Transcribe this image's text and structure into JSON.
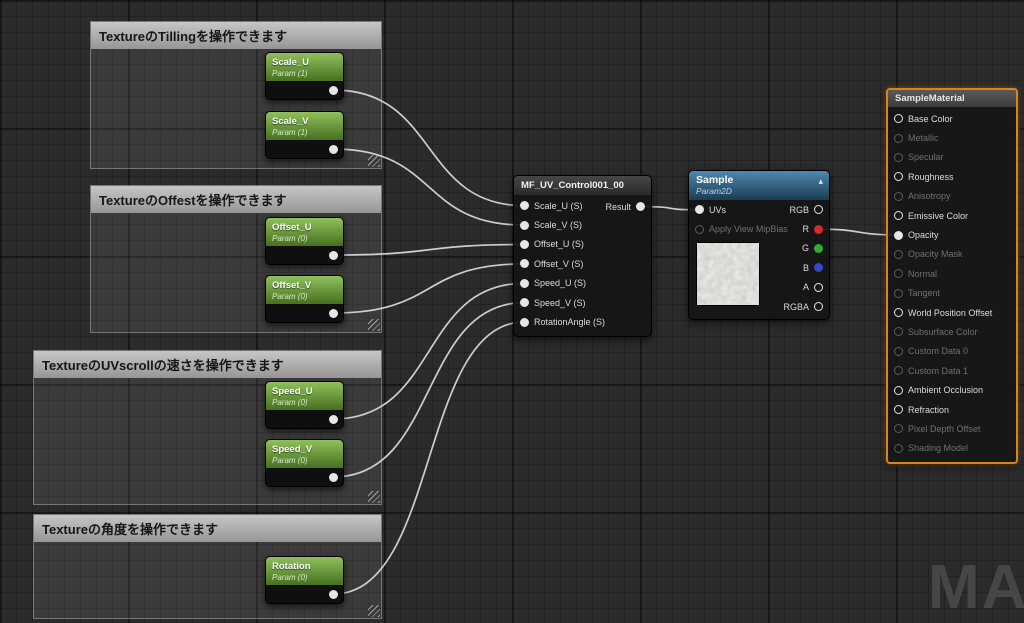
{
  "comments": [
    {
      "title": "TextureのTillingを操作できます"
    },
    {
      "title": "TextureのOffestを操作できます"
    },
    {
      "title": "TextureのUVscrollの速さを操作できます"
    },
    {
      "title": "Textureの角度を操作できます"
    }
  ],
  "param_nodes": [
    {
      "name": "Scale_U",
      "sub": "Param (1)"
    },
    {
      "name": "Scale_V",
      "sub": "Param (1)"
    },
    {
      "name": "Offset_U",
      "sub": "Param (0)"
    },
    {
      "name": "Offset_V",
      "sub": "Param (0)"
    },
    {
      "name": "Speed_U",
      "sub": "Param (0)"
    },
    {
      "name": "Speed_V",
      "sub": "Param (0)"
    },
    {
      "name": "Rotation",
      "sub": "Param (0)"
    }
  ],
  "mf_node": {
    "title": "MF_UV_Control001_00",
    "inputs": [
      "Scale_U (S)",
      "Scale_V (S)",
      "Offset_U (S)",
      "Offset_V (S)",
      "Speed_U (S)",
      "Speed_V (S)",
      "RotationAngle (S)"
    ],
    "output": "Result"
  },
  "sample_node": {
    "title": "Sample",
    "subtitle": "Param2D",
    "inputs": [
      {
        "label": "UVs",
        "active": true,
        "filled": true
      },
      {
        "label": "Apply View MipBias",
        "active": false,
        "filled": false
      }
    ],
    "outputs": [
      {
        "label": "RGB",
        "color": ""
      },
      {
        "label": "R",
        "color": "#d42a2a",
        "filled": true
      },
      {
        "label": "G",
        "color": "#2fae2f",
        "filled": true
      },
      {
        "label": "B",
        "color": "#3648c8",
        "filled": true
      },
      {
        "label": "A",
        "color": ""
      },
      {
        "label": "RGBA",
        "color": ""
      }
    ]
  },
  "material_node": {
    "title": "SampleMaterial",
    "pins": [
      {
        "label": "Base Color",
        "active": true,
        "filled": false
      },
      {
        "label": "Metallic",
        "active": false,
        "filled": false
      },
      {
        "label": "Specular",
        "active": false,
        "filled": false
      },
      {
        "label": "Roughness",
        "active": true,
        "filled": false
      },
      {
        "label": "Anisotropy",
        "active": false,
        "filled": false
      },
      {
        "label": "Emissive Color",
        "active": true,
        "filled": false
      },
      {
        "label": "Opacity",
        "active": true,
        "filled": true
      },
      {
        "label": "Opacity Mask",
        "active": false,
        "filled": false
      },
      {
        "label": "Normal",
        "active": false,
        "filled": false
      },
      {
        "label": "Tangent",
        "active": false,
        "filled": false
      },
      {
        "label": "World Position Offset",
        "active": true,
        "filled": false
      },
      {
        "label": "Subsurface Color",
        "active": false,
        "filled": false
      },
      {
        "label": "Custom Data 0",
        "active": false,
        "filled": false
      },
      {
        "label": "Custom Data 1",
        "active": false,
        "filled": false
      },
      {
        "label": "Ambient Occlusion",
        "active": true,
        "filled": false
      },
      {
        "label": "Refraction",
        "active": true,
        "filled": false
      },
      {
        "label": "Pixel Depth Offset",
        "active": false,
        "filled": false
      },
      {
        "label": "Shading Model",
        "active": false,
        "filled": false
      }
    ]
  },
  "connections": [
    [
      "out:Scale_U",
      "in:Scale_U (S)"
    ],
    [
      "out:Scale_V",
      "in:Scale_V (S)"
    ],
    [
      "out:Offset_U",
      "in:Offset_U (S)"
    ],
    [
      "out:Offset_V",
      "in:Offset_V (S)"
    ],
    [
      "out:Speed_U",
      "in:Speed_U (S)"
    ],
    [
      "out:Speed_V",
      "in:Speed_V (S)"
    ],
    [
      "out:Rotation",
      "in:RotationAngle (S)"
    ],
    [
      "out:Result",
      "in:UVs"
    ],
    [
      "out:R",
      "in:Opacity"
    ]
  ],
  "watermark": "MAT"
}
